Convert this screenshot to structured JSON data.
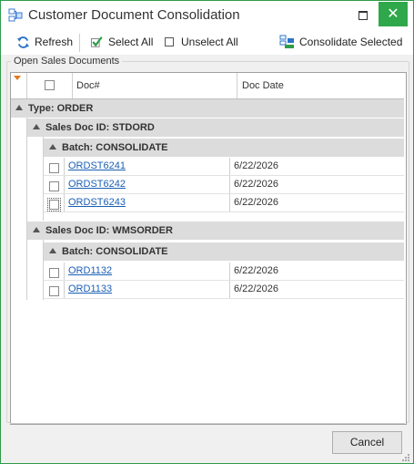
{
  "window": {
    "title": "Customer Document Consolidation",
    "close_glyph": "✕"
  },
  "toolbar": {
    "refresh_label": "Refresh",
    "select_all_label": "Select All",
    "unselect_all_label": "Unselect All",
    "consolidate_label": "Consolidate Selected"
  },
  "section": {
    "legend": "Open Sales Documents"
  },
  "grid": {
    "columns": {
      "doc": "Doc#",
      "date": "Doc Date"
    },
    "type_group": "Type: ORDER",
    "groups": [
      {
        "label": "Sales Doc ID: STDORD",
        "batch": "Batch: CONSOLIDATE",
        "rows": [
          {
            "doc": "ORDST6241",
            "date": "6/22/2026"
          },
          {
            "doc": "ORDST6242",
            "date": "6/22/2026"
          },
          {
            "doc": "ORDST6243",
            "date": "6/22/2026"
          }
        ]
      },
      {
        "label": "Sales Doc ID: WMSORDER",
        "batch": "Batch: CONSOLIDATE",
        "rows": [
          {
            "doc": "ORD1132",
            "date": "6/22/2026"
          },
          {
            "doc": "ORD1133",
            "date": "6/22/2026"
          }
        ]
      }
    ]
  },
  "footer": {
    "cancel_label": "Cancel"
  },
  "colors": {
    "accent": "#2ea84a",
    "link": "#1a5fb4",
    "group_bg": "#dcdcdc"
  }
}
